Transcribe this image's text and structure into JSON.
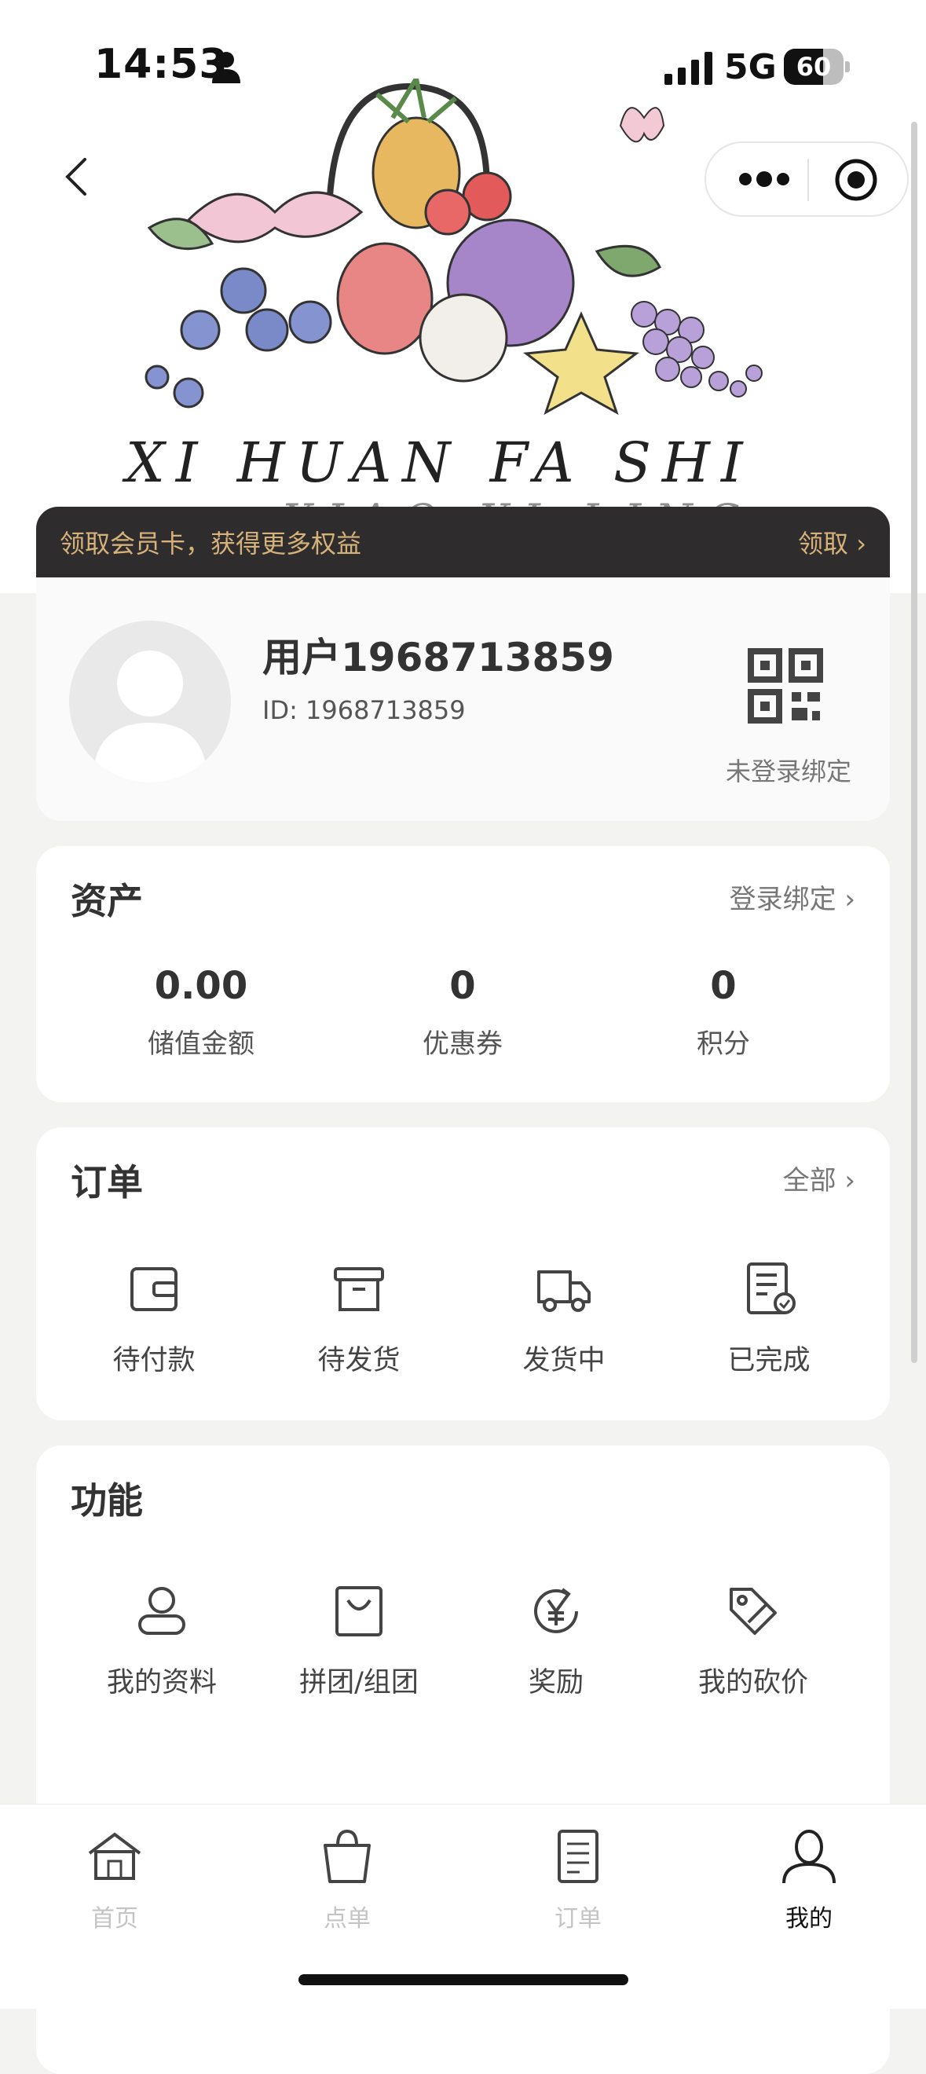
{
  "status_bar": {
    "time": "14:53",
    "network": "5G",
    "battery": "60"
  },
  "hero": {
    "script_line1": "XI HUAN FA SHI",
    "script_line2": "XIAO XI LING"
  },
  "member_bar": {
    "text": "领取会员卡，获得更多权益",
    "action": "领取 ›"
  },
  "profile": {
    "username": "用户1968713859",
    "user_id": "ID: 1968713859",
    "qr_label": "未登录绑定"
  },
  "assets": {
    "title": "资产",
    "link": "登录绑定 ›",
    "items": [
      {
        "value": "0.00",
        "label": "储值金额"
      },
      {
        "value": "0",
        "label": "优惠券"
      },
      {
        "value": "0",
        "label": "积分"
      }
    ]
  },
  "orders": {
    "title": "订单",
    "link": "全部 ›",
    "items": [
      {
        "label": "待付款",
        "icon": "wallet-icon"
      },
      {
        "label": "待发货",
        "icon": "box-icon"
      },
      {
        "label": "发货中",
        "icon": "truck-icon"
      },
      {
        "label": "已完成",
        "icon": "completed-doc-icon"
      }
    ]
  },
  "features": {
    "title": "功能",
    "items": [
      {
        "label": "我的资料",
        "icon": "profile-icon"
      },
      {
        "label": "拼团/组团",
        "icon": "shopping-bag-icon"
      },
      {
        "label": "奖励",
        "icon": "yen-reward-icon"
      },
      {
        "label": "我的砍价",
        "icon": "price-tag-icon"
      }
    ]
  },
  "tabbar": {
    "tabs": [
      {
        "label": "首页",
        "icon": "house-icon",
        "active": false
      },
      {
        "label": "点单",
        "icon": "bag-icon",
        "active": false
      },
      {
        "label": "订单",
        "icon": "receipt-icon",
        "active": false
      },
      {
        "label": "我的",
        "icon": "person-icon",
        "active": true
      }
    ]
  },
  "colors": {
    "accent_gold": "#d6b27b",
    "member_bar_bg": "#2e2c2c",
    "page_bg": "#f3f3f1"
  }
}
